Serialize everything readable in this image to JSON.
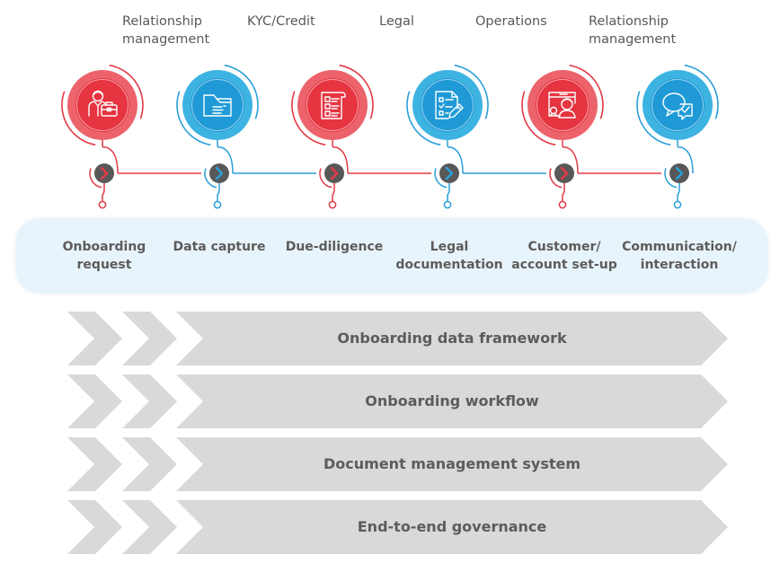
{
  "colors": {
    "red_outer": "#ec636b",
    "red_inner": "#e63440",
    "red_line": "#e23a46",
    "blue_outer": "#3db3e2",
    "blue_inner": "#1f9ad6",
    "blue_line": "#2a9fd9",
    "node_dark": "#585858",
    "band_bg": "#e7f4fb",
    "layer_bg": "#d9d9d9",
    "text": "#5d5b5b"
  },
  "stages": [
    {
      "role": "",
      "step": "Onboarding\nrequest",
      "color": "red",
      "icon": "businessman-briefcase-icon"
    },
    {
      "role": "Relationship\nmanagement",
      "step": "Data capture",
      "color": "blue",
      "icon": "folder-document-icon"
    },
    {
      "role": "KYC/Credit",
      "step": "Due-diligence",
      "color": "red",
      "icon": "checklist-scroll-icon"
    },
    {
      "role": "Legal",
      "step": "Legal\ndocumentation",
      "color": "blue",
      "icon": "document-edit-pencil-icon"
    },
    {
      "role": "Operations",
      "step": "Customer/\naccount set-up",
      "color": "red",
      "icon": "user-screen-setup-icon"
    },
    {
      "role": "Relationship\nmanagement",
      "step": "Communication/\ninteraction",
      "color": "blue",
      "icon": "chat-bubbles-check-icon"
    }
  ],
  "roles_top": [
    {
      "label": "Relationship\nmanagement"
    },
    {
      "label": "KYC/Credit"
    },
    {
      "label": "Legal"
    },
    {
      "label": "Operations"
    },
    {
      "label": "Relationship\nmanagement"
    }
  ],
  "layers": [
    {
      "label": "Onboarding data framework"
    },
    {
      "label": "Onboarding workflow"
    },
    {
      "label": "Document management system"
    },
    {
      "label": "End-to-end governance"
    }
  ]
}
